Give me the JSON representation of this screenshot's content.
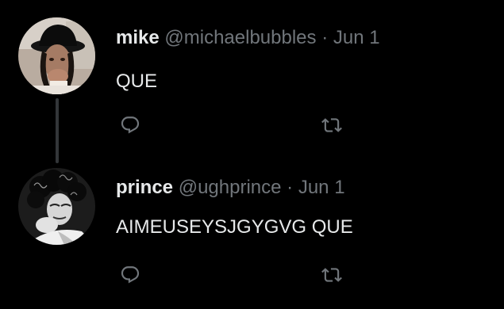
{
  "tweets": [
    {
      "name": "mike",
      "handle": "@michaelbubbles",
      "separator": "·",
      "date": "Jun 1",
      "text": "QUE",
      "avatar_icon": "profile-photo"
    },
    {
      "name": "prince",
      "handle": "@ughprince",
      "separator": "·",
      "date": "Jun 1",
      "text": "AIMEUSEYSJGYGVG QUE",
      "avatar_icon": "profile-photo"
    }
  ],
  "icons": {
    "reply": "reply-icon",
    "retweet": "retweet-icon"
  },
  "colors": {
    "background": "#000000",
    "primary_text": "#e7e9ea",
    "secondary_text": "#71767b",
    "thread_line": "#333639"
  }
}
